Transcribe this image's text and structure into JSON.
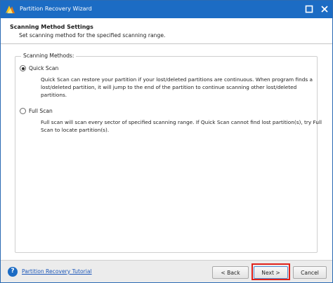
{
  "window": {
    "title": "Partition Recovery Wizard",
    "accent_color": "#1c6cc4",
    "app_icon": "partition-wizard-logo-icon",
    "maximize_icon": "maximize-icon",
    "close_icon": "close-icon"
  },
  "header": {
    "title": "Scanning Method Settings",
    "subtitle": "Set scanning method for the specified scanning range."
  },
  "scan_methods": {
    "group_label": "Scanning Methods:",
    "options": [
      {
        "label": "Quick Scan",
        "selected": true,
        "description_lines": [
          "Quick Scan can restore your partition if your lost/deleted partitions are continuous. When program finds a",
          "lost/deleted partition, it will jump to the end of the partition to continue scanning other lost/deleted",
          "partitions."
        ]
      },
      {
        "label": "Full Scan",
        "selected": false,
        "description_lines": [
          "Full scan will scan every sector of specified scanning range. If Quick Scan cannot find lost partition(s), try Full",
          "Scan to locate partition(s)."
        ]
      }
    ]
  },
  "footer": {
    "help_icon": "question-icon",
    "help_icon_glyph": "?",
    "tutorial_link": "Partition Recovery Tutorial",
    "back_label": "< Back",
    "next_label": "Next >",
    "cancel_label": "Cancel",
    "highlight_color": "#e0221b"
  }
}
